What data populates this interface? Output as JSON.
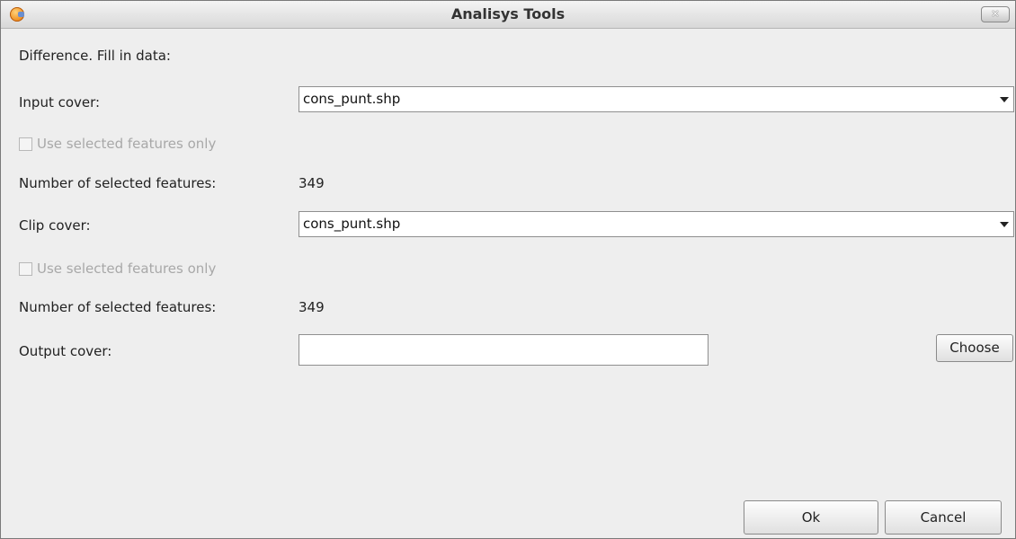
{
  "window": {
    "title": "Analisys Tools"
  },
  "form": {
    "heading": "Difference. Fill in data:",
    "input_cover": {
      "label": "Input cover:",
      "value": "cons_punt.shp",
      "checkbox_label": "Use selected features only",
      "checkbox_checked": false,
      "count_label": "Number of selected features:",
      "count_value": "349"
    },
    "clip_cover": {
      "label": "Clip cover:",
      "value": "cons_punt.shp",
      "checkbox_label": "Use selected features only",
      "checkbox_checked": false,
      "count_label": "Number of selected features:",
      "count_value": "349"
    },
    "output_cover": {
      "label": "Output cover:",
      "value": "",
      "choose_label": "Choose"
    }
  },
  "footer": {
    "ok_label": "Ok",
    "cancel_label": "Cancel"
  },
  "icons": {
    "app": "app-logo-icon",
    "close": "close-icon",
    "dropdown": "chevron-down-icon"
  }
}
